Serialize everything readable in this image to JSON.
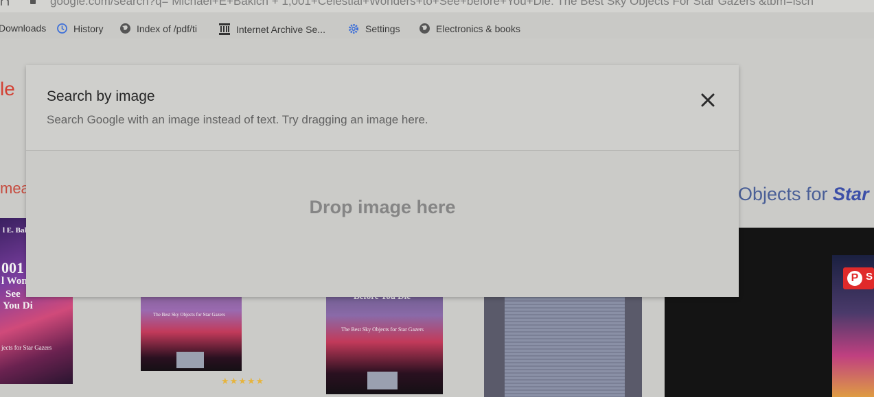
{
  "address_bar": {
    "url": "google.com/search?q= Michael+E+Bakich + 1,001+Celestial+Wonders+to+See+before+You+Die: The Best Sky Objects For Star Gazers &tbm=isch"
  },
  "bookmarks": [
    {
      "label": "Downloads",
      "icon": "download-icon"
    },
    {
      "label": "History",
      "icon": "history-icon"
    },
    {
      "label": "Index of /pdf/ti",
      "icon": "globe-icon"
    },
    {
      "label": "Internet Archive Se...",
      "icon": "archive-icon"
    },
    {
      "label": "Settings",
      "icon": "gear-icon"
    },
    {
      "label": "Electronics & books",
      "icon": "globe-icon"
    }
  ],
  "background_page": {
    "logo_fragment": "le",
    "tab_fragment": "mea",
    "result_title_prefix": "Objects for ",
    "result_title_emph": "Star",
    "cover1": {
      "lines": [
        "l E. Bak",
        "001",
        "l Wonde",
        "See",
        "You Di",
        "jects for Star Gazers"
      ]
    },
    "cover2": {
      "subtitle": "The Best Sky Objects for Star Gazers"
    },
    "cover3": {
      "top": "Before You Die",
      "subtitle": "The Best Sky Objects for Star Gazers"
    },
    "stars": "★★★★★",
    "pin_label": "S"
  },
  "dialog": {
    "title": "Search by image",
    "subtitle": "Search Google with an image instead of text. Try dragging an image here.",
    "drop_label": "Drop image here",
    "close_icon": "close-icon"
  },
  "colors": {
    "accent_blue": "#3d6fd8",
    "pinterest_red": "#e02a2a"
  }
}
